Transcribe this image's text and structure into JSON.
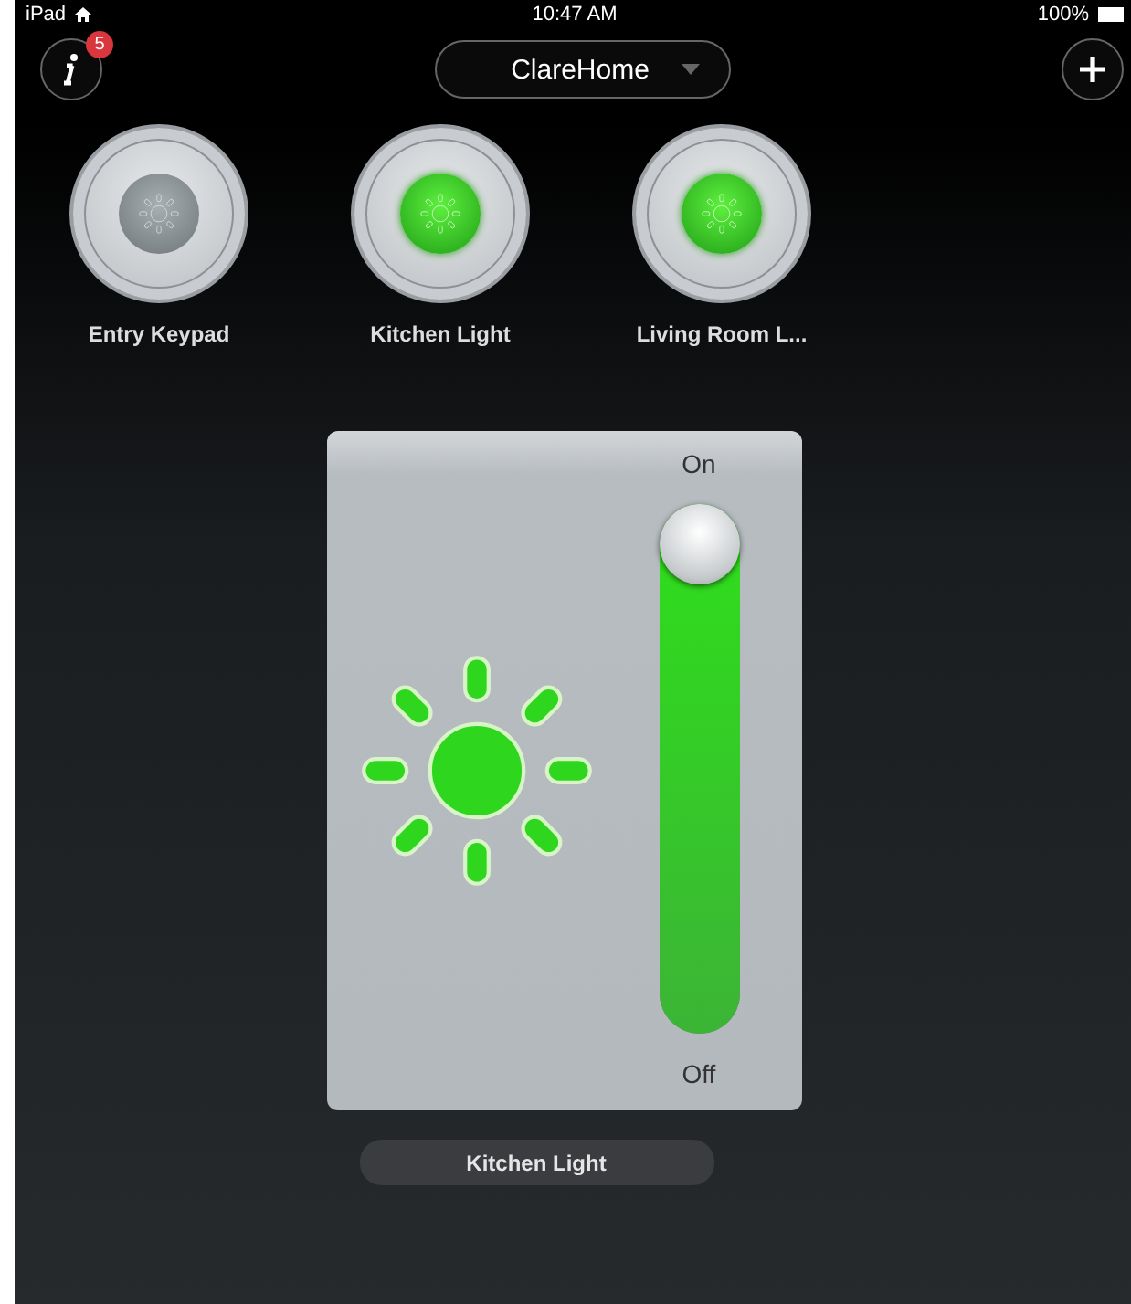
{
  "status_bar": {
    "device": "iPad",
    "time": "10:47 AM",
    "battery": "100%"
  },
  "header": {
    "info_badge": "5",
    "home_selector": "ClareHome"
  },
  "devices": [
    {
      "label": "Entry Keypad",
      "on": false
    },
    {
      "label": "Kitchen Light",
      "on": true
    },
    {
      "label": "Living Room L...",
      "on": true
    }
  ],
  "dimmer": {
    "on": true,
    "max_label": "On",
    "min_label": "Off",
    "level": 1,
    "device_name": "Kitchen Light"
  }
}
